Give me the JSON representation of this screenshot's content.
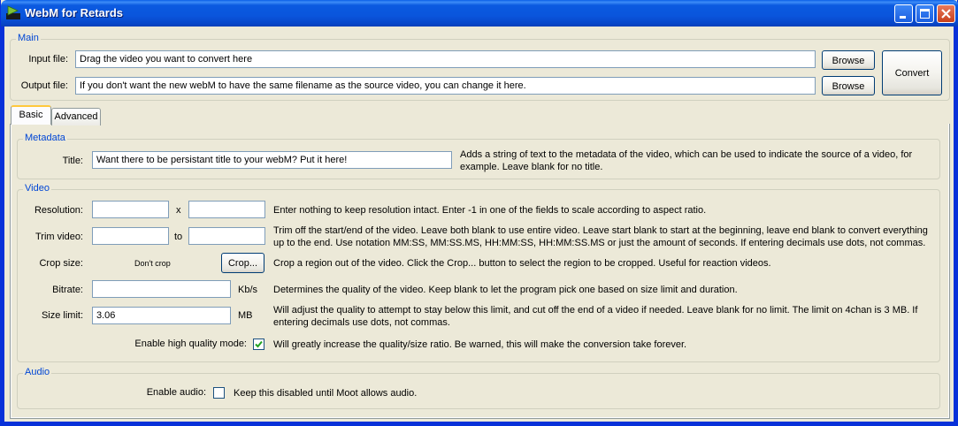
{
  "window": {
    "title": "WebM for Retards",
    "controls": {
      "minimize_icon": "minimize-icon",
      "maximize_icon": "maximize-icon",
      "close_icon": "close-icon"
    }
  },
  "main": {
    "group_title": "Main",
    "input_label": "Input file:",
    "input_value": "Drag the video you want to convert here",
    "output_label": "Output file:",
    "output_value": "If you don't want the new webM to have the same filename as the source video, you can change it here.",
    "browse_label": "Browse",
    "convert_label": "Convert"
  },
  "tabs": [
    {
      "label": "Basic",
      "active": true
    },
    {
      "label": "Advanced",
      "active": false
    }
  ],
  "metadata": {
    "group_title": "Metadata",
    "title_label": "Title:",
    "title_value": "Want there to be persistant title to your webM? Put it here!",
    "title_desc": "Adds a string of text to the metadata of the video, which can be used to indicate the source of a video, for example. Leave blank for no title."
  },
  "video": {
    "group_title": "Video",
    "resolution_label": "Resolution:",
    "resolution_sep": "x",
    "resolution_desc": "Enter nothing to keep resolution intact. Enter -1 in one of the fields to scale according to aspect ratio.",
    "trim_label": "Trim video:",
    "trim_sep": "to",
    "trim_desc": "Trim off the start/end of the video. Leave both blank to use entire video. Leave start blank to start at the beginning, leave end blank to convert everything up to the end. Use notation MM:SS, MM:SS.MS, HH:MM:SS, HH:MM:SS.MS or just the amount of seconds. If entering decimals use dots, not commas.",
    "crop_label": "Crop size:",
    "crop_value": "Don't crop",
    "crop_button": "Crop...",
    "crop_desc": "Crop a region out of the video. Click the Crop... button to select the region to be cropped. Useful for reaction videos.",
    "bitrate_label": "Bitrate:",
    "bitrate_unit": "Kb/s",
    "bitrate_desc": "Determines the quality of the video. Keep blank to let the program pick one based on size limit and duration.",
    "size_label": "Size limit:",
    "size_value": "3.06",
    "size_unit": "MB",
    "size_desc": "Will adjust the quality to attempt to stay below this limit, and cut off the end of a video if needed. Leave blank for no limit. The limit on 4chan is 3 MB. If entering decimals use dots, not commas.",
    "hq_label": "Enable high quality mode:",
    "hq_checked": true,
    "hq_desc": "Will greatly increase the quality/size ratio. Be warned, this will make the conversion take forever."
  },
  "audio": {
    "group_title": "Audio",
    "enable_label": "Enable audio:",
    "enabled": false,
    "enable_desc": "Keep this disabled until Moot allows audio."
  },
  "colors": {
    "titlebar": "#0a55dc",
    "group_title": "#0046d5",
    "window_bg": "#ece9d8"
  }
}
